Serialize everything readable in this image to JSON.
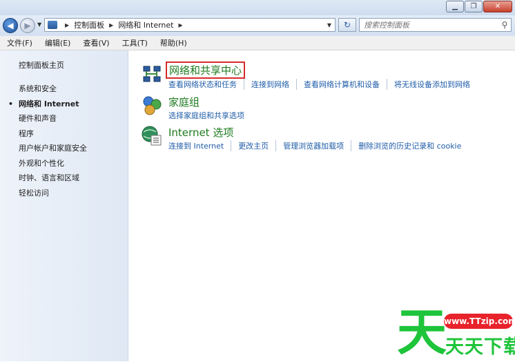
{
  "window": {
    "minimize_icon": "minimize-icon",
    "maximize_icon": "maximize-icon",
    "close_icon": "close-icon"
  },
  "nav": {
    "breadcrumbs": [
      "控制面板",
      "网络和 Internet"
    ],
    "search_placeholder": "搜索控制面板",
    "back_icon": "back-arrow-icon",
    "forward_icon": "forward-arrow-icon",
    "refresh_icon": "refresh-icon",
    "search_icon": "search-icon"
  },
  "menu": [
    "文件(F)",
    "编辑(E)",
    "查看(V)",
    "工具(T)",
    "帮助(H)"
  ],
  "sidebar": {
    "home": "控制面板主页",
    "items": [
      {
        "label": "系统和安全",
        "active": false
      },
      {
        "label": "网络和 Internet",
        "active": true
      },
      {
        "label": "硬件和声音",
        "active": false
      },
      {
        "label": "程序",
        "active": false
      },
      {
        "label": "用户帐户和家庭安全",
        "active": false
      },
      {
        "label": "外观和个性化",
        "active": false
      },
      {
        "label": "时钟、语言和区域",
        "active": false
      },
      {
        "label": "轻松访问",
        "active": false
      }
    ]
  },
  "categories": [
    {
      "title": "网络和共享中心",
      "icon": "network-sharing-center-icon",
      "highlighted": true,
      "links": [
        "查看网络状态和任务",
        "连接到网络",
        "查看网络计算机和设备",
        "将无线设备添加到网络"
      ]
    },
    {
      "title": "家庭组",
      "icon": "homegroup-icon",
      "highlighted": false,
      "links": [
        "选择家庭组和共享选项"
      ]
    },
    {
      "title": "Internet 选项",
      "icon": "internet-options-icon",
      "highlighted": false,
      "links": [
        "连接到 Internet",
        "更改主页",
        "管理浏览器加载项",
        "删除浏览的历史记录和 cookie"
      ]
    }
  ],
  "watermark": {
    "big_char": "天",
    "url": "www.TTzip.com",
    "name": "天天下载"
  },
  "colors": {
    "link": "#1f5ca8",
    "category_title": "#1e7a1e",
    "highlight_box": "#d62b2b",
    "watermark_green": "#1ec43a",
    "watermark_red": "#e8232b"
  }
}
